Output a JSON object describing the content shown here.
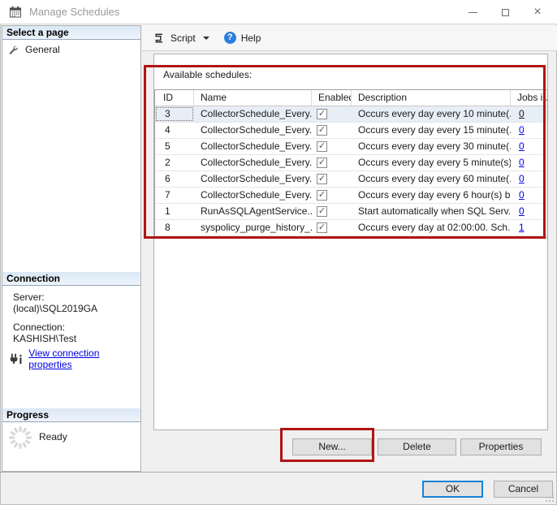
{
  "window": {
    "title": "Manage Schedules"
  },
  "sidebar": {
    "select_page_header": "Select a page",
    "pages": [
      {
        "label": "General",
        "icon": "wrench-icon"
      }
    ],
    "connection_header": "Connection",
    "server_label": "Server:",
    "server_value": "(local)\\SQL2019GA",
    "connection_label": "Connection:",
    "connection_value": "KASHISH\\Test",
    "view_connection_link": "View connection properties",
    "progress_header": "Progress",
    "progress_status": "Ready"
  },
  "toolbar": {
    "script_label": "Script",
    "help_label": "Help",
    "help_icon": "help-question-icon",
    "script_icon": "script-icon"
  },
  "main": {
    "available_label": "Available schedules:",
    "table": {
      "columns": [
        "ID",
        "Name",
        "Enabled",
        "Description",
        "Jobs i..."
      ],
      "rows": [
        {
          "id": "3",
          "name": "CollectorSchedule_Every...",
          "enabled": true,
          "description": "Occurs every day every 10 minute(...",
          "jobs": "0",
          "selected": true
        },
        {
          "id": "4",
          "name": "CollectorSchedule_Every...",
          "enabled": true,
          "description": "Occurs every day every 15 minute(...",
          "jobs": "0"
        },
        {
          "id": "5",
          "name": "CollectorSchedule_Every...",
          "enabled": true,
          "description": "Occurs every day every 30 minute(...",
          "jobs": "0"
        },
        {
          "id": "2",
          "name": "CollectorSchedule_Every...",
          "enabled": true,
          "description": "Occurs every day every 5 minute(s)...",
          "jobs": "0"
        },
        {
          "id": "6",
          "name": "CollectorSchedule_Every...",
          "enabled": true,
          "description": "Occurs every day every 60 minute(...",
          "jobs": "0"
        },
        {
          "id": "7",
          "name": "CollectorSchedule_Every...",
          "enabled": true,
          "description": "Occurs every day every 6 hour(s) b...",
          "jobs": "0"
        },
        {
          "id": "1",
          "name": "RunAsSQLAgentService...",
          "enabled": true,
          "description": "Start automatically when SQL Serv...",
          "jobs": "0"
        },
        {
          "id": "8",
          "name": "syspolicy_purge_history_...",
          "enabled": true,
          "description": "Occurs every day at 02:00:00. Sch...",
          "jobs": "1"
        }
      ]
    },
    "buttons": {
      "new": "New...",
      "delete": "Delete",
      "properties": "Properties"
    }
  },
  "footer": {
    "ok": "OK",
    "cancel": "Cancel"
  },
  "colors": {
    "annotation_red": "#b11414",
    "accent_blue": "#1883d7",
    "link_blue": "#0000e6",
    "selected_row_bg": "#e8eef6"
  }
}
